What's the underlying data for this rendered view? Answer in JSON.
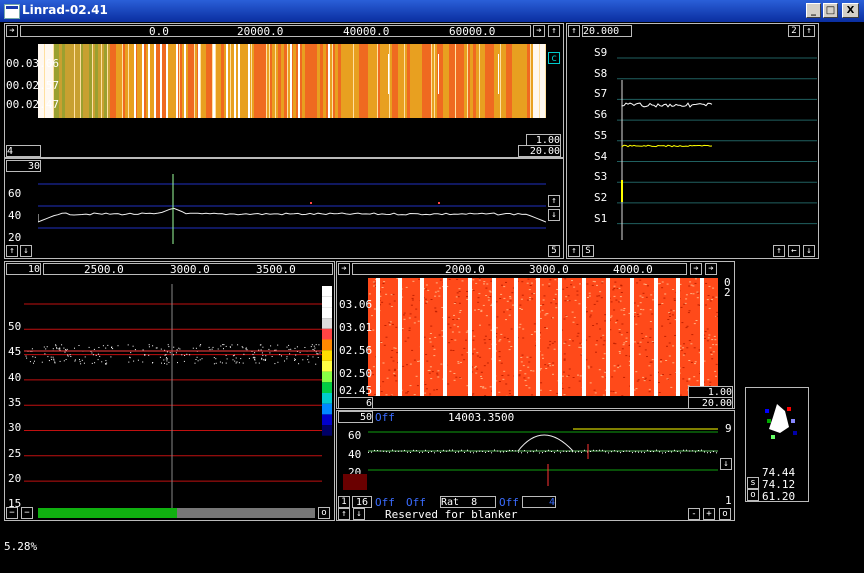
{
  "window": {
    "title": "Linrad-02.41",
    "min_symbol": "_",
    "max_symbol": "□",
    "close_symbol": "X"
  },
  "colors": {
    "titlebar": "#0a2ea0",
    "waterfall_hot": "#ff4a1a",
    "waterfall_warm": "#e8a020",
    "grid_blue": "#2030c0",
    "grid_red": "#c01010",
    "grid_green": "#10a010",
    "grid_teal": "#206060"
  },
  "wide_waterfall": {
    "freq_ticks": [
      "0.0",
      "20000.0",
      "40000.0",
      "60000.0"
    ],
    "times": [
      "00.03.06",
      "00.02.57",
      "00.02.47"
    ],
    "c_button": "c",
    "avg_value": "4",
    "gain_value": "1.00",
    "zero_value": "20.00"
  },
  "wide_spectrum": {
    "avg_value": "30",
    "y_ticks": [
      "60",
      "40",
      "20"
    ],
    "scale_value": "5"
  },
  "smeter": {
    "value": "20.000",
    "label_2": "2",
    "levels": [
      "S9",
      "S8",
      "S7",
      "S6",
      "S5",
      "S4",
      "S3",
      "S2",
      "S1"
    ],
    "s_button": "S"
  },
  "baseband": {
    "avg_value": "10",
    "freq_ticks": [
      "2500.0",
      "3000.0",
      "3500.0"
    ],
    "y_ticks": [
      "50",
      "45",
      "40",
      "35",
      "30",
      "25",
      "20",
      "15"
    ],
    "o_button": "o"
  },
  "hires_waterfall": {
    "freq_ticks": [
      "2000.0",
      "3000.0",
      "4000.0"
    ],
    "times": [
      "03.06",
      "03.01",
      "02.56",
      "02.50",
      "02.45"
    ],
    "side_0": "0",
    "side_2": "2",
    "avg_value": "6",
    "gain_value": "1.00",
    "zero_value": "20.00"
  },
  "afc": {
    "avg_value": "50",
    "off_label": "Off",
    "frequency": "14003.3500",
    "y_ticks": [
      "60",
      "40",
      "20"
    ],
    "right_9": "9",
    "right_1": "1",
    "btn_1": "1",
    "btn_16": "16",
    "off_a": "Off",
    "off_b": "Off",
    "rat_label": "Rat",
    "rat_value": "8",
    "off_c": "Off",
    "off_c_value": "4",
    "reserved_text": "Reserved for blanker",
    "minus": "-",
    "plus": "+",
    "o_button": "o"
  },
  "polarization": {
    "s_label": "s",
    "o_label": "o",
    "values": [
      "74.44",
      "74.12",
      "61.20"
    ]
  },
  "status": {
    "cpu_load": "5.28%"
  }
}
